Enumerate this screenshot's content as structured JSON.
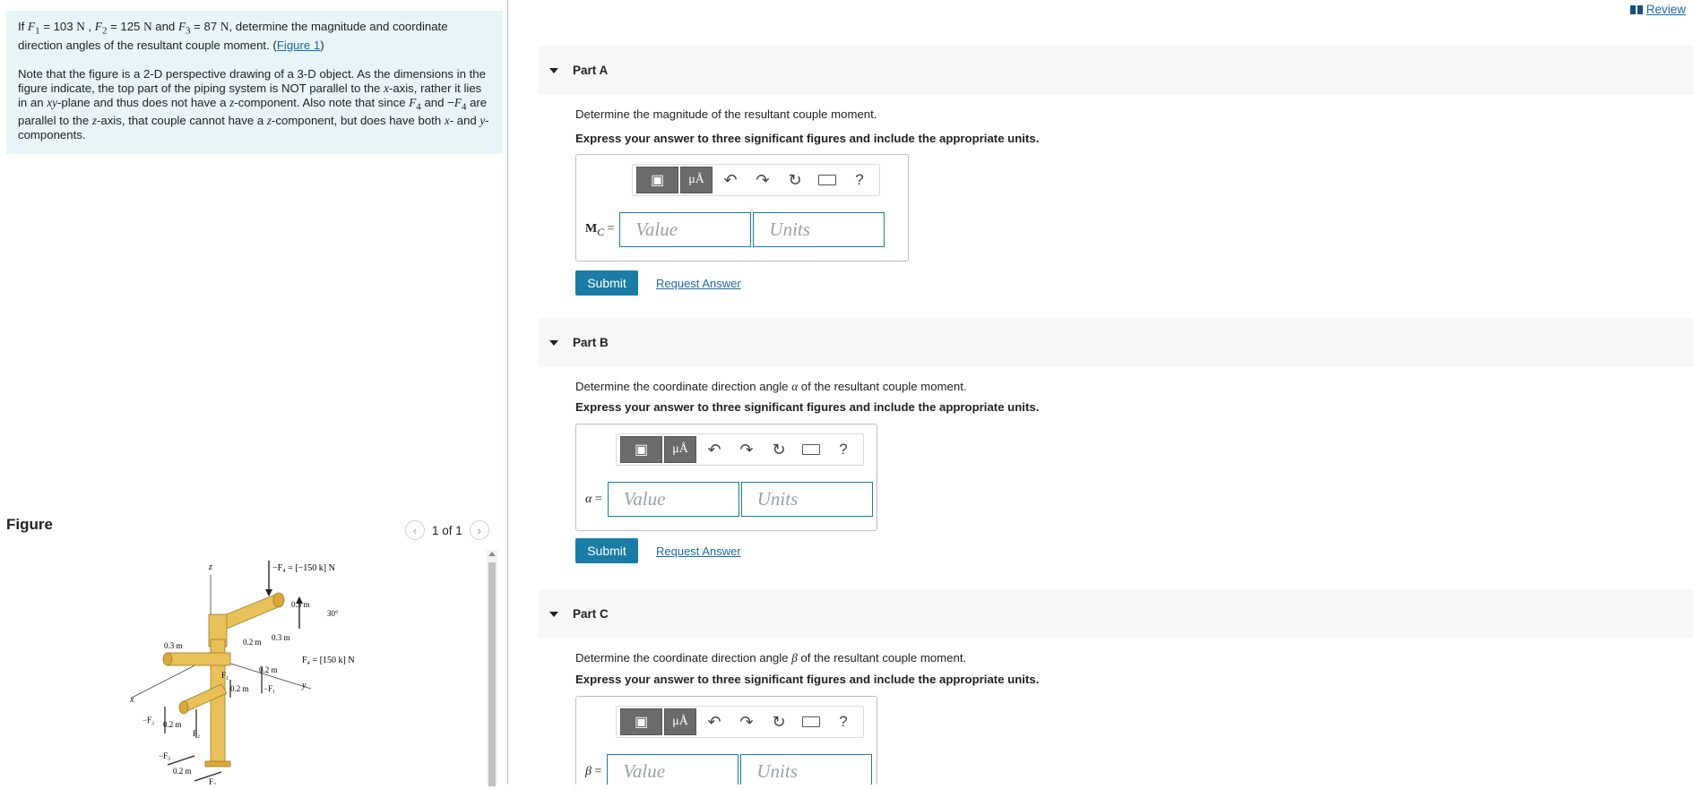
{
  "problem": {
    "p1_if": "If ",
    "F1_var": "F",
    "F1_sub": "1",
    "F1_val": " = 103 ",
    "F1_unit": "N",
    "comma1": " , ",
    "F2_var": "F",
    "F2_sub": "2",
    "F2_val": " = 125 ",
    "F2_unit": "N",
    "and1": " and ",
    "F3_var": "F",
    "F3_sub": "3",
    "F3_val": " = 87 ",
    "F3_unit": "N",
    "p1_rest": ", determine the magnitude and coordinate direction angles of the resultant couple moment. (",
    "figure_link": "Figure 1",
    "p1_close": ")",
    "p2_a": "Note that the figure is a 2-D perspective drawing of a 3-D object. As the dimensions in the figure indicate, the top part of the piping system is NOT parallel to the ",
    "x_axis": "x",
    "p2_b": "-axis, rather it lies in an ",
    "xy_plane": "xy",
    "p2_c": "-plane and thus does not have a ",
    "z1": "z",
    "p2_d": "-component. Also note that since ",
    "F4a_var": "F",
    "F4a_sub": "4",
    "p2_e": " and −",
    "F4b_var": "F",
    "F4b_sub": "4",
    "p2_f": " are parallel to the ",
    "z2": "z",
    "p2_g": "-axis, that couple cannot have a ",
    "z3": "z",
    "p2_h": "-component, but does have both ",
    "x2": "x",
    "p2_i": "- and ",
    "y2": "y",
    "p2_j": "-components."
  },
  "figure": {
    "title": "Figure",
    "pager": "1 of 1",
    "labels": {
      "z": "z",
      "x": "x",
      "y": "y",
      "f4_top": "−F₄ = [−150 k] N",
      "f4_right": "F₄ = [150 k] N",
      "d_03_top": "0.3 m",
      "angle_30": "30°",
      "d_03_mid": "0.3 m",
      "d_02_upper": "0.2 m",
      "d_03_left": "0.3 m",
      "d_02_right": "0.2 m",
      "f1": "F₁",
      "d_02_mid": "0.2 m",
      "neg_f1": "−F₁",
      "neg_f2": "−F₂",
      "d_02_left": "0.2 m",
      "f2": "F₂",
      "neg_f3": "−F₃",
      "d_02_bottom": "0.2 m",
      "f3": "F₃"
    }
  },
  "review": "Review",
  "parts": [
    {
      "label": "Part A",
      "question_a": "Determine the magnitude of the resultant couple moment.",
      "question_sym": "",
      "question_b": "",
      "instruction": "Express your answer to three significant figures and include the appropriate units.",
      "var_main": "M",
      "var_sub": "C",
      "var_eq": " =",
      "value_placeholder": "Value",
      "units_placeholder": "Units",
      "submit": "Submit",
      "request": "Request Answer"
    },
    {
      "label": "Part B",
      "question_a": "Determine the coordinate direction angle ",
      "question_sym": "α",
      "question_b": " of the resultant couple moment.",
      "instruction": "Express your answer to three significant figures and include the appropriate units.",
      "var_main": "α",
      "var_sub": "",
      "var_eq": " =",
      "value_placeholder": "Value",
      "units_placeholder": "Units",
      "submit": "Submit",
      "request": "Request Answer"
    },
    {
      "label": "Part C",
      "question_a": "Determine the coordinate direction angle ",
      "question_sym": "β",
      "question_b": " of the resultant couple moment.",
      "instruction": "Express your answer to three significant figures and include the appropriate units.",
      "var_main": "β",
      "var_sub": "",
      "var_eq": " =",
      "value_placeholder": "Value",
      "units_placeholder": "Units"
    }
  ],
  "toolbar": {
    "matrix_icon": "matrix-template-icon",
    "mu_label": "μÅ",
    "undo_glyph": "↶",
    "redo_glyph": "↷",
    "reset_glyph": "↻",
    "keyboard_icon": "keyboard-icon",
    "help": "?"
  },
  "colors": {
    "problem_bg": "#e7f5f8",
    "link": "#1a6aa8",
    "submit_bg": "#1a7ca6",
    "field_border": "#1a7caa",
    "pipe": "#e8c15a"
  }
}
